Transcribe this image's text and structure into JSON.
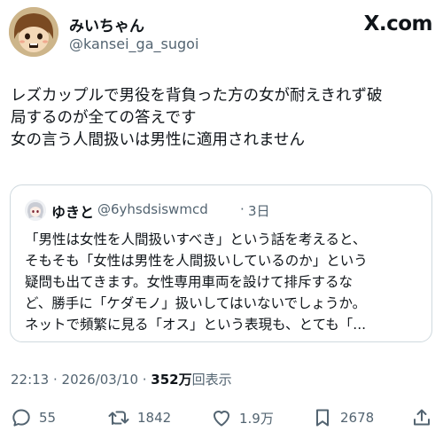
{
  "author": {
    "display_name": "みいちゃん",
    "handle": "@kansei_ga_sugoi",
    "avatar_icon": "cartoon-avatar-icon"
  },
  "brand": {
    "label": "X.com"
  },
  "tweet": {
    "lines": [
      "レズカップルで男役を背負った方の女が耐えきれず破",
      "局するのが全ての答えです",
      "女の言う人間扱いは男性に適用されません"
    ]
  },
  "quote": {
    "display_name": "ゆきと",
    "handle": "@6yhsdsiswmcd",
    "separator": "·",
    "time": "3日",
    "lines": [
      "「男性は女性を人間扱いすべき」という話を考えると、",
      "そもそも「女性は男性を人間扱いしているのか」という",
      "疑問も出てきます。女性専用車両を設けて排斥するな",
      "ど、勝手に「ケダモノ」扱いしてはいないでしょうか。",
      "ネットで頻繁に見る「オス」という表現も、とても「..."
    ]
  },
  "meta": {
    "timestamp": "22:13 · 2026/03/10 · ",
    "views_count": "352万",
    "views_label": "回表示"
  },
  "actions": {
    "reply_count": "55",
    "retweet_count": "1842",
    "like_count": "1.9万",
    "bookmark_count": "2678"
  },
  "colors": {
    "text_primary": "#0f1419",
    "text_secondary": "#536471",
    "border": "#cfd9de"
  }
}
